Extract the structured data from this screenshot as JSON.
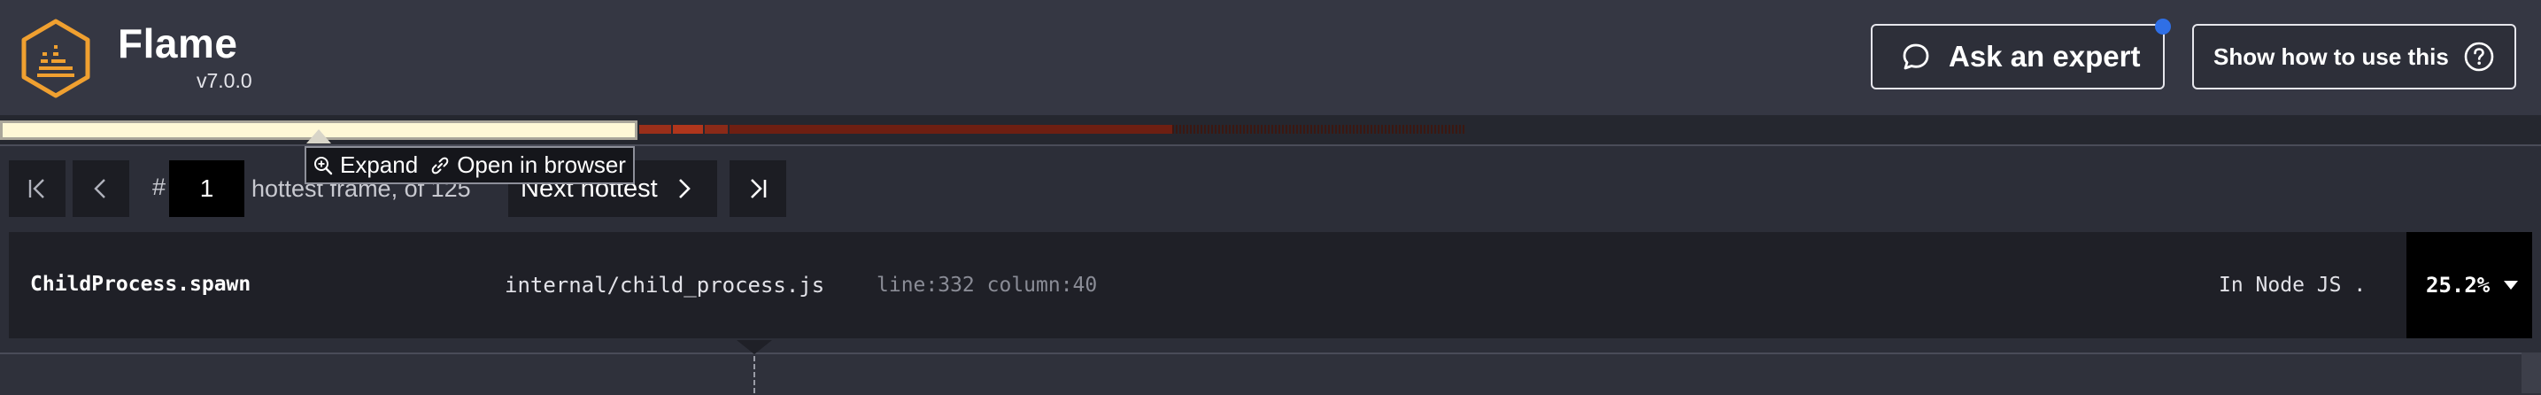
{
  "header": {
    "title": "Flame",
    "version": "v7.0.0",
    "ask_label": "Ask an expert",
    "help_label": "Show how to use this",
    "notification_color": "#2f6fe6",
    "logo_icon": "flame-hexagon-logo",
    "logo_color": "#f0a030"
  },
  "strip": {
    "selected_color": "#fff8d6",
    "hot_color": "#8a2a1a"
  },
  "tooltip": {
    "expand_label": "Expand",
    "open_label": "Open in browser",
    "expand_icon": "zoom-in-icon",
    "open_icon": "link-icon"
  },
  "nav": {
    "hash": "#",
    "frame_index": "1",
    "hottest_label": "hottest frame, of 125",
    "next_label": "Next hottest"
  },
  "frame": {
    "function_name": "ChildProcess.spawn",
    "file": "internal/child_process.js",
    "position": "line:332 column:40",
    "context": "In Node JS .",
    "percent": "25.2%"
  }
}
